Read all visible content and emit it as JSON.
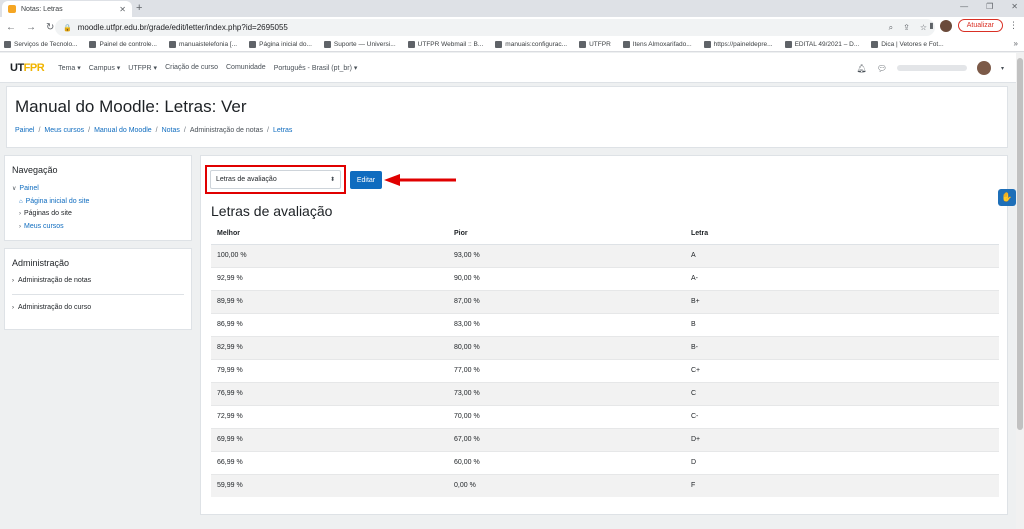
{
  "browser": {
    "tab_title": "Notas: Letras",
    "tab_close": "✕",
    "new_tab": "+",
    "url": "moodle.utfpr.edu.br/grade/edit/letter/index.php?id=2695055",
    "update_label": "Atualizar",
    "bookmarks": [
      "Serviços de Tecnolo...",
      "Painel de controle...",
      "manuaistelefonia [...",
      "Página inicial do...",
      "Suporte — Universi...",
      "UTFPR Webmail :: B...",
      "manuais:configurac...",
      "UTFPR",
      "Itens Almoxarifado...",
      "https://paineldepre...",
      "EDITAL 49/2021 – D...",
      "Dica | Vetores e Fot..."
    ],
    "bookmarks_more": "»"
  },
  "navbar": {
    "logo_a": "UT",
    "logo_b": "FPR",
    "items": [
      "Tema ▾",
      "Campus ▾",
      "UTFPR ▾",
      "Criação de curso",
      "Comunidade",
      "Português - Brasil (pt_br) ▾"
    ]
  },
  "header": {
    "title": "Manual do Moodle: Letras: Ver",
    "breadcrumb": [
      "Painel",
      "Meus cursos",
      "Manual do Moodle",
      "Notas",
      "Administração de notas",
      "Letras"
    ]
  },
  "nav_block": {
    "title": "Navegação",
    "items": [
      "Painel",
      "Página inicial do site",
      "Páginas do site",
      "Meus cursos"
    ]
  },
  "admin_block": {
    "title": "Administração",
    "items": [
      "Administração de notas",
      "Administração do curso"
    ]
  },
  "main": {
    "select_value": "Letras de avaliação",
    "edit_label": "Editar",
    "section_title": "Letras de avaliação",
    "columns": [
      "Melhor",
      "Pior",
      "Letra"
    ],
    "rows": [
      [
        "100,00 %",
        "93,00 %",
        "A"
      ],
      [
        "92,99 %",
        "90,00 %",
        "A-"
      ],
      [
        "89,99 %",
        "87,00 %",
        "B+"
      ],
      [
        "86,99 %",
        "83,00 %",
        "B"
      ],
      [
        "82,99 %",
        "80,00 %",
        "B-"
      ],
      [
        "79,99 %",
        "77,00 %",
        "C+"
      ],
      [
        "76,99 %",
        "73,00 %",
        "C"
      ],
      [
        "72,99 %",
        "70,00 %",
        "C-"
      ],
      [
        "69,99 %",
        "67,00 %",
        "D+"
      ],
      [
        "66,99 %",
        "60,00 %",
        "D"
      ],
      [
        "59,99 %",
        "0,00 %",
        "F"
      ]
    ]
  },
  "colors": {
    "link": "#0f6cbf",
    "button": "#0f6cbf",
    "highlight": "#e00000"
  }
}
